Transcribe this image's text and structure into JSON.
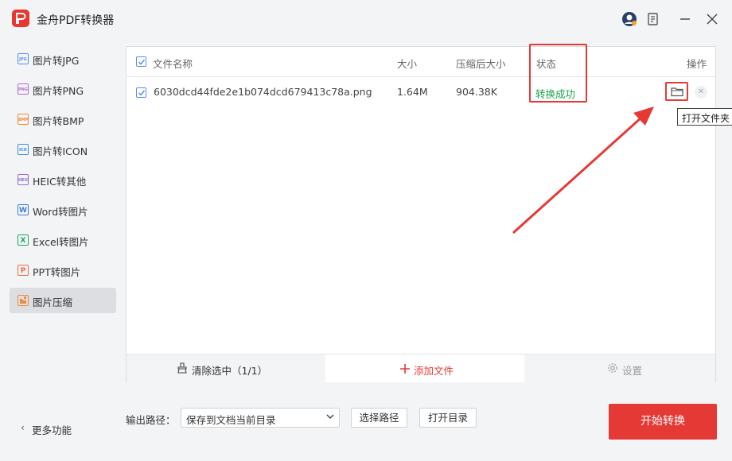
{
  "app": {
    "title": "金舟PDF转换器"
  },
  "sidebar": {
    "items": [
      {
        "label": "图片转JPG",
        "icon": "jpg-icon",
        "badge": "JPG",
        "color": "#5b8def"
      },
      {
        "label": "图片转PNG",
        "icon": "png-icon",
        "badge": "PNG",
        "color": "#b06fd6"
      },
      {
        "label": "图片转BMP",
        "icon": "bmp-icon",
        "badge": "BMP",
        "color": "#f08a3c"
      },
      {
        "label": "图片转ICON",
        "icon": "ico-icon",
        "badge": "ICO",
        "color": "#3b8fe0"
      },
      {
        "label": "HEIC转其他",
        "icon": "heic-icon",
        "badge": "HEIC",
        "color": "#9a6ad0"
      },
      {
        "label": "Word转图片",
        "icon": "word-icon",
        "badge": "W",
        "color": "#3b7be0"
      },
      {
        "label": "Excel转图片",
        "icon": "excel-icon",
        "badge": "X",
        "color": "#25a35a"
      },
      {
        "label": "PPT转图片",
        "icon": "ppt-icon",
        "badge": "P",
        "color": "#f06a3c"
      },
      {
        "label": "图片压缩",
        "icon": "compress-icon",
        "badge": "",
        "color": "#f08a3c",
        "active": true
      }
    ],
    "more_label": "更多功能"
  },
  "table": {
    "headers": {
      "name": "文件名称",
      "size": "大小",
      "compressed": "压缩后大小",
      "status": "状态",
      "ops": "操作"
    },
    "rows": [
      {
        "name": "6030dcd44fde2e1b074dcd679413c78a.png",
        "size": "1.64M",
        "compressed": "904.38K",
        "status": "转换成功",
        "checked": true
      }
    ],
    "tooltip": "打开文件夹"
  },
  "panel_footer": {
    "clear_label": "清除选中（1/1）",
    "add_label": "添加文件",
    "settings_label": "设置"
  },
  "bottom": {
    "output_label": "输出路径：",
    "output_value": "保存到文档当前目录",
    "choose_path_label": "选择路径",
    "open_dir_label": "打开目录",
    "start_label": "开始转换"
  },
  "colors": {
    "accent": "#e53935",
    "success": "#1aa34a",
    "check": "#5b8def"
  }
}
